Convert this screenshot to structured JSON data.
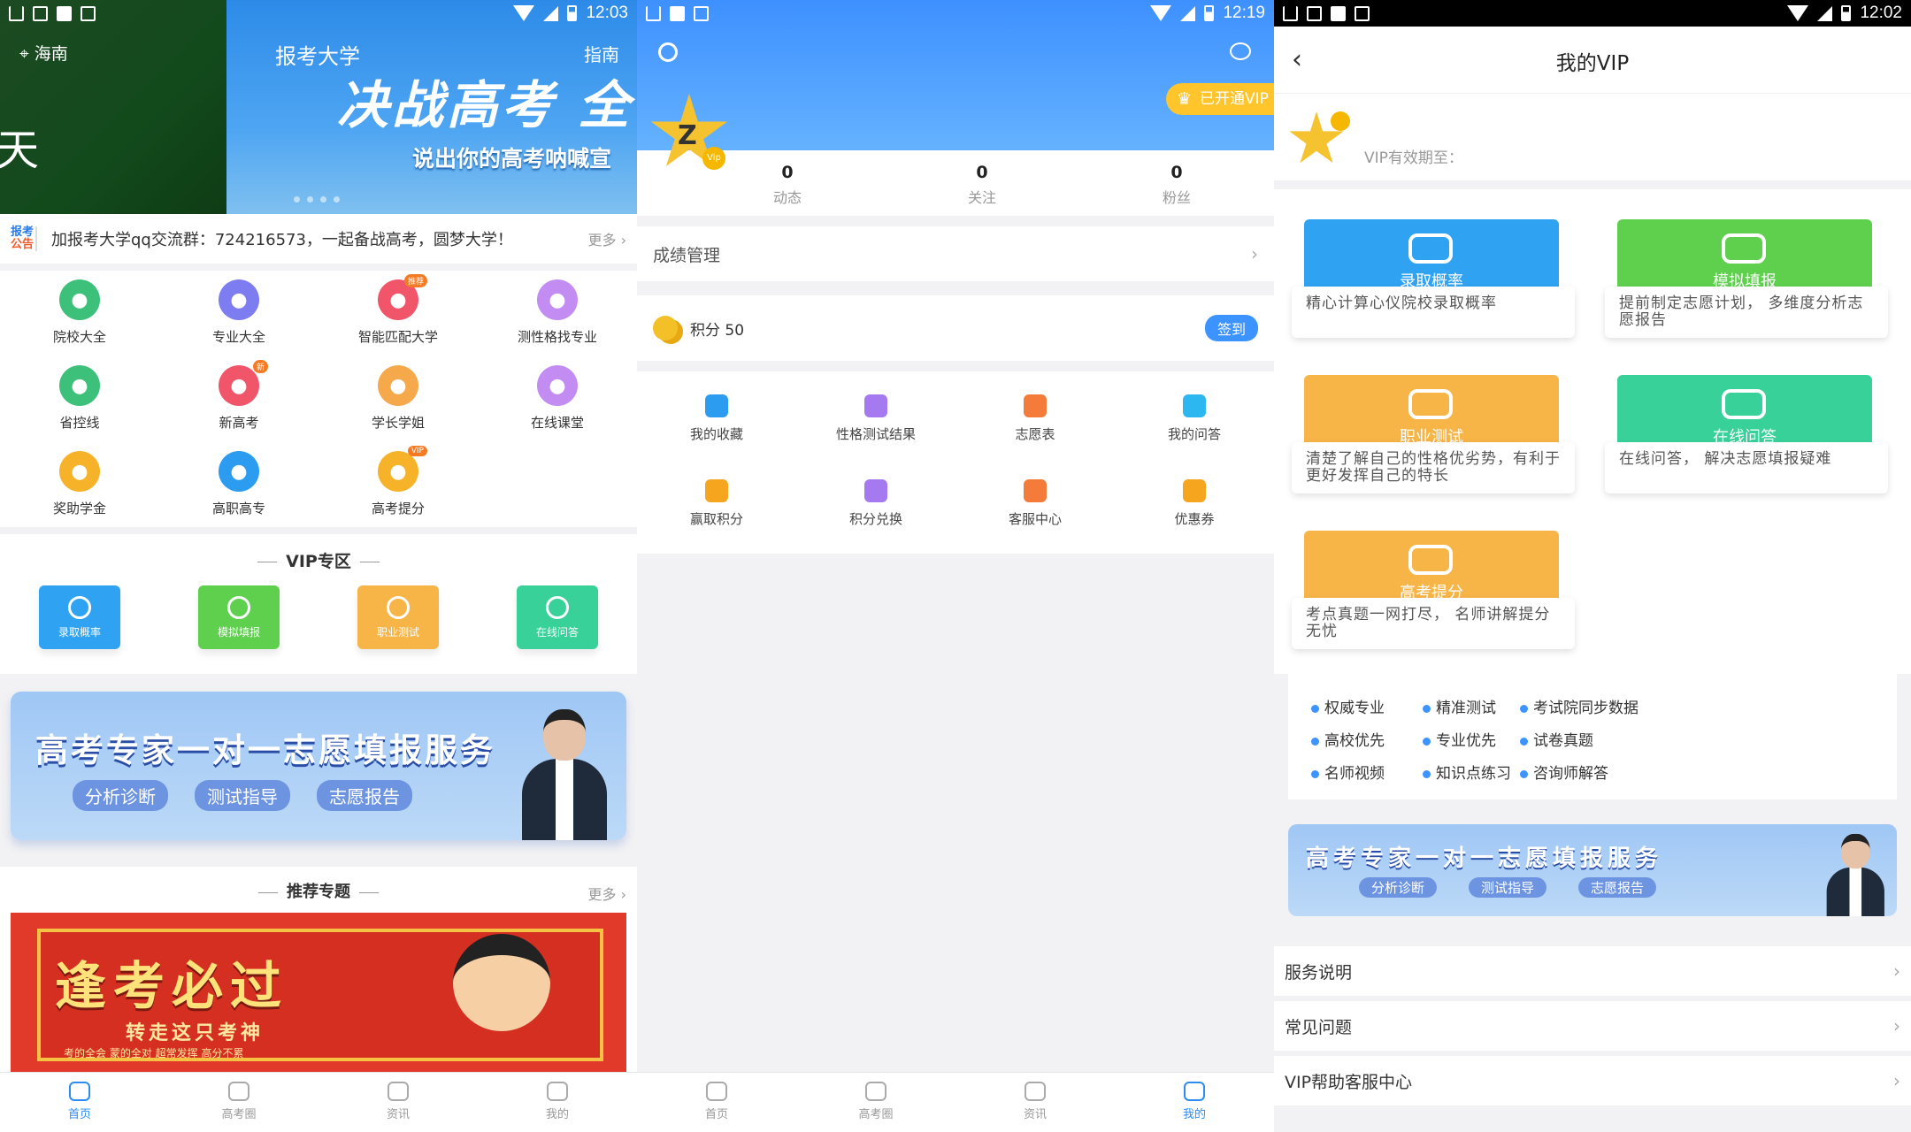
{
  "screen1": {
    "status_time": "12:03",
    "location": "海南",
    "left_banner_char": "天",
    "banner": {
      "title_small": "报考大学",
      "title_right": "指南",
      "headline": "决战高考 全",
      "subline": "说出你的高考呐喊宣"
    },
    "notice": {
      "tag_top": "报考",
      "tag_bottom": "公告",
      "text": "加报考大学qq交流群：724216573，一起备战高考，圆梦大学！",
      "more": "更多 ›"
    },
    "grid": [
      {
        "label": "院校大全",
        "icon": "school-icon",
        "color": "#3cc07a"
      },
      {
        "label": "专业大全",
        "icon": "grid-icon",
        "color": "#7d7cf0"
      },
      {
        "label": "智能匹配大学",
        "icon": "match-icon",
        "color": "#f0556a",
        "badge": "推荐"
      },
      {
        "label": "测性格找专业",
        "icon": "star-icon",
        "color": "#c28cf2"
      },
      {
        "label": "省控线",
        "icon": "chart-icon",
        "color": "#3cc07a"
      },
      {
        "label": "新高考",
        "icon": "graduation-icon",
        "color": "#f0556a",
        "badge": "新"
      },
      {
        "label": "学长学姐",
        "icon": "people-icon",
        "color": "#f6a94b"
      },
      {
        "label": "在线课堂",
        "icon": "play-icon",
        "color": "#c28cf2"
      },
      {
        "label": "奖助学金",
        "icon": "money-bag-icon",
        "color": "#f6b32a"
      },
      {
        "label": "高职高专",
        "icon": "home-icon",
        "color": "#2c9cf0"
      },
      {
        "label": "高考提分",
        "icon": "rocket-icon",
        "color": "#f6b32a",
        "badge": "VIP"
      }
    ],
    "vip_section_title": "VIP专区",
    "vip_cards": [
      {
        "label": "录取概率",
        "color": "#2fa3f2"
      },
      {
        "label": "模拟填报",
        "color": "#5ed04e"
      },
      {
        "label": "职业测试",
        "color": "#f7b548"
      },
      {
        "label": "在线问答",
        "color": "#38d19a"
      }
    ],
    "promo": {
      "title": "高考专家一对一志愿填报服务",
      "pills": [
        "分析诊断",
        "测试指导",
        "志愿报告"
      ]
    },
    "recommend": {
      "title": "推荐专题",
      "more": "更多 ›",
      "banner_big": "逢考必过",
      "banner_sub": "转走这只考神",
      "banner_small": "考的全会 蒙的全对 超常发挥 高分不累"
    },
    "tabs": [
      "首页",
      "高考圈",
      "资讯",
      "我的"
    ]
  },
  "screen2": {
    "status_time": "12:19",
    "vip_badge": "已开通VIP",
    "vip_dot": "Vip",
    "avatar_letter": "Z",
    "stats": [
      {
        "value": "0",
        "label": "动态"
      },
      {
        "value": "0",
        "label": "关注"
      },
      {
        "value": "0",
        "label": "粉丝"
      }
    ],
    "score_mgmt": "成绩管理",
    "points_label": "积分 50",
    "sign_btn": "签到",
    "grid": [
      {
        "label": "我的收藏",
        "color": "#2c9cf0"
      },
      {
        "label": "性格测试结果",
        "color": "#a57af0"
      },
      {
        "label": "志愿表",
        "color": "#f57b3a"
      },
      {
        "label": "我的问答",
        "color": "#2cb7f0"
      },
      {
        "label": "赢取积分",
        "color": "#f6a61e"
      },
      {
        "label": "积分兑换",
        "color": "#a57af0"
      },
      {
        "label": "客服中心",
        "color": "#f57b3a"
      },
      {
        "label": "优惠券",
        "color": "#f6a61e"
      }
    ],
    "tabs": [
      "首页",
      "高考圈",
      "资讯",
      "我的"
    ]
  },
  "screen3": {
    "status_time": "12:02",
    "title": "我的VIP",
    "vip_valid_label": "VIP有效期至：",
    "cards": [
      {
        "title": "录取概率",
        "desc": "精心计算心仪院校录取概率",
        "color": "#2fa3f2"
      },
      {
        "title": "模拟填报",
        "desc": "提前制定志愿计划， 多维度分析志愿报告",
        "color": "#5ed04e"
      },
      {
        "title": "职业测试",
        "desc": "清楚了解自己的性格优劣势，有利于更好发挥自己的特长",
        "color": "#f7b548"
      },
      {
        "title": "在线问答",
        "desc": "在线问答， 解决志愿填报疑难",
        "color": "#38d19a"
      },
      {
        "title": "高考提分",
        "desc": "考点真题一网打尽， 名师讲解提分无忧",
        "color": "#f7b548"
      }
    ],
    "features": [
      "权威专业",
      "精准测试",
      "考试院同步数据",
      "高校优先",
      "专业优先",
      "试卷真题",
      "名师视频",
      "知识点练习",
      "咨询师解答"
    ],
    "promo": {
      "title": "高考专家一对一志愿填报服务",
      "pills": [
        "分析诊断",
        "测试指导",
        "志愿报告"
      ]
    },
    "menu": [
      "服务说明",
      "常见问题",
      "VIP帮助客服中心"
    ]
  }
}
